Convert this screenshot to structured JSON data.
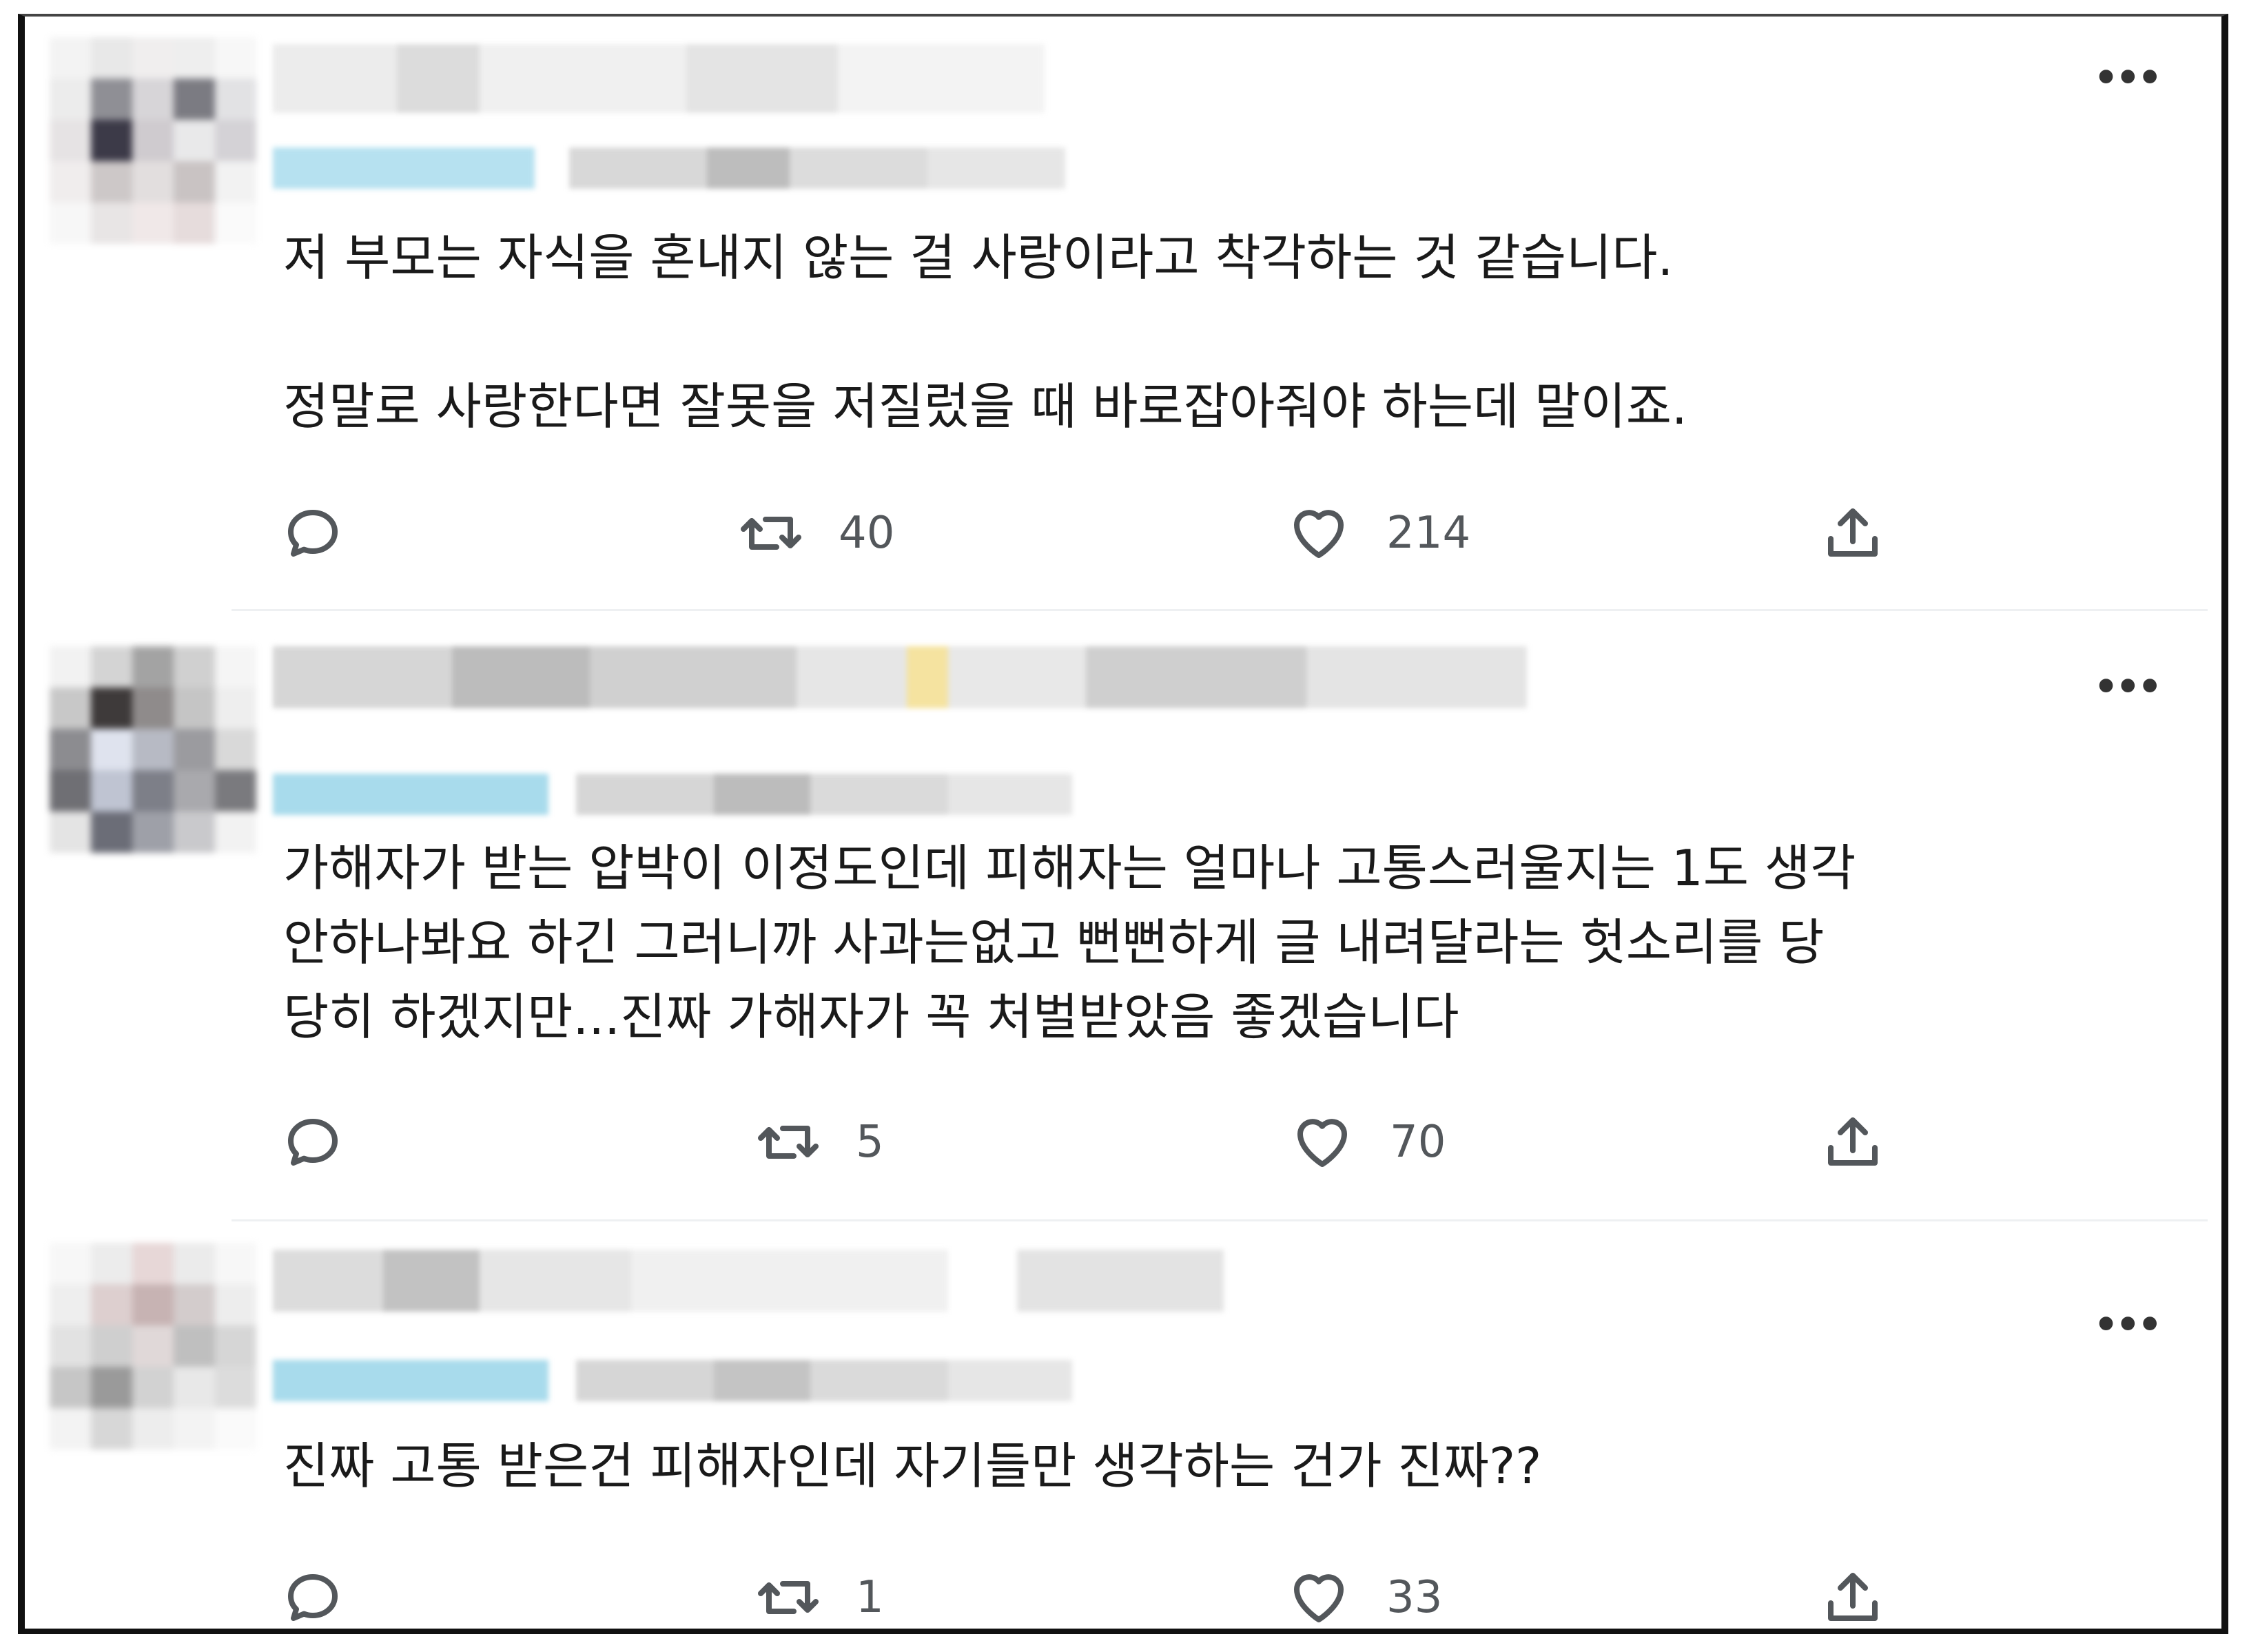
{
  "tweets": [
    {
      "text": "저 부모는 자식을 혼내지 않는 걸 사랑이라고 착각하는 것 같습니다.\n\n정말로 사랑한다면 잘못을 저질렀을 때 바로잡아줘야 하는데 말이죠.",
      "reply_count": "",
      "retweet_count": "40",
      "like_count": "214"
    },
    {
      "text": "가해자가 받는 압박이 이정도인데 피해자는 얼마나 고통스러울지는 1도 생각\n안하나봐요 하긴 그러니까 사과는없고 뻔뻔하게 글 내려달라는 헛소리를 당\n당히 하겠지만...진짜 가해자가 꼭 처벌받았음 좋겠습니다",
      "reply_count": "",
      "retweet_count": "5",
      "like_count": "70"
    },
    {
      "text": "진짜 고통 받은건 피해자인데 자기들만 생각하는 건가 진짜??",
      "reply_count": "",
      "retweet_count": "1",
      "like_count": "33"
    }
  ],
  "icons": {
    "more": "more-horizontal-icon",
    "reply": "reply-bubble-icon",
    "retweet": "retweet-icon",
    "like": "heart-icon",
    "share": "share-upload-icon"
  },
  "colors": {
    "text": "#1a1a1a",
    "icon": "#53575b",
    "separator": "#eef0f2",
    "handle_blur": "#a8dbec"
  },
  "more_glyph": "•••"
}
